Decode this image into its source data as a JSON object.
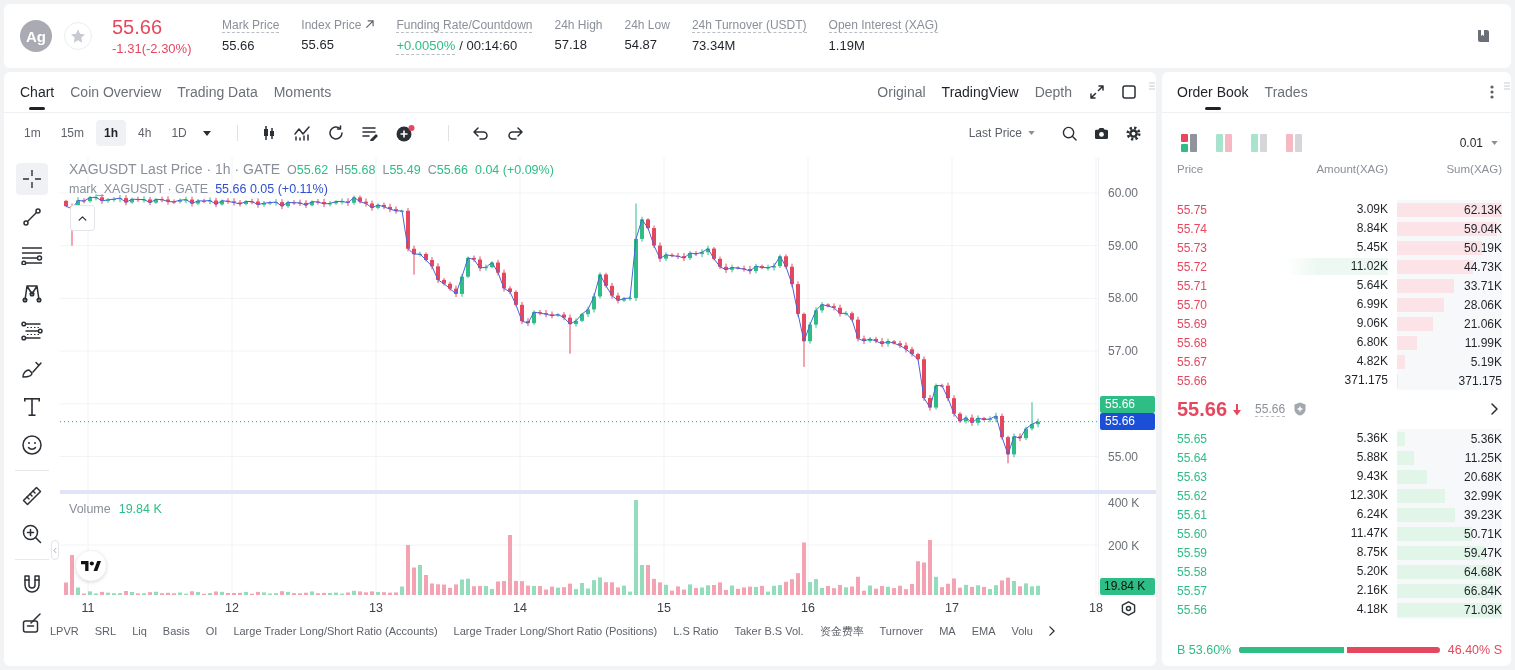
{
  "header": {
    "symbol": "Ag",
    "last_price": "55.66",
    "change": "-1.31(-2.30%)",
    "stats": [
      {
        "kind": "hint",
        "label": "Mark Price",
        "value": "55.66"
      },
      {
        "kind": "link",
        "label": "Index Price",
        "value": "55.65"
      },
      {
        "kind": "funding",
        "label": "Funding Rate/Countdown",
        "value": "+0.0050%",
        "countdown": "/ 00:14:60"
      },
      {
        "kind": "plain",
        "label": "24h High",
        "value": "57.18"
      },
      {
        "kind": "plain",
        "label": "24h Low",
        "value": "54.87"
      },
      {
        "kind": "hint",
        "label": "24h Turnover (USDT)",
        "value": "73.34M"
      },
      {
        "kind": "hint",
        "label": "Open Interest (XAG)",
        "value": "1.19M"
      }
    ]
  },
  "chart_panel": {
    "tabs": [
      {
        "label": "Chart",
        "selected": true
      },
      {
        "label": "Coin Overview",
        "selected": false
      },
      {
        "label": "Trading Data",
        "selected": false
      },
      {
        "label": "Moments",
        "selected": false
      }
    ],
    "views": [
      {
        "label": "Original",
        "selected": false
      },
      {
        "label": "TradingView",
        "selected": true
      },
      {
        "label": "Depth",
        "selected": false
      }
    ],
    "intervals": [
      {
        "label": "1m",
        "selected": false
      },
      {
        "label": "15m",
        "selected": false
      },
      {
        "label": "1h",
        "selected": true
      },
      {
        "label": "4h",
        "selected": false
      },
      {
        "label": "1D",
        "selected": false
      }
    ],
    "price_source": "Last Price",
    "drawing_tools": [
      {
        "selected": true
      },
      {
        "selected": false
      },
      {
        "selected": false
      },
      {
        "selected": false
      },
      {
        "selected": false
      },
      {
        "selected": false
      },
      {
        "selected": false
      },
      {
        "selected": false
      },
      {
        "selected": false
      },
      {
        "selected": false
      },
      {
        "selected": false
      },
      {
        "selected": false
      }
    ],
    "legend": {
      "title": "XAGUSDT Last Price · 1h · GATE",
      "ohlc": [
        {
          "key": "O",
          "value": "55.62"
        },
        {
          "key": "H",
          "value": "55.68"
        },
        {
          "key": "L",
          "value": "55.49"
        },
        {
          "key": "C",
          "value": "55.66"
        }
      ],
      "change": "0.04 (+0.09%)"
    },
    "mark_legend": {
      "title": "mark_XAGUSDT · GATE",
      "values": "55.66 0.05 (+0.11%)"
    },
    "price_axis": [
      "60.00",
      "59.00",
      "58.00",
      "57.00",
      "55.00"
    ],
    "price_badges": [
      {
        "value": "55.66",
        "color": "#2ebd85"
      },
      {
        "value": "55.66",
        "color": "#1c4fd8"
      }
    ],
    "volume": {
      "label": "Volume",
      "value": "19.84 K",
      "axis": [
        "400 K",
        "200 K"
      ],
      "badge": "19.84 K"
    },
    "time_axis": [
      "11",
      "12",
      "13",
      "14",
      "15",
      "16",
      "17",
      "18"
    ],
    "indicators": [
      "LPVR",
      "SRL",
      "Liq",
      "Basis",
      "OI",
      "Large Trader Long/Short Ratio (Accounts)",
      "Large Trader Long/Short Ratio (Positions)",
      "L.S Ratio",
      "Taker B.S Vol.",
      "资金费率",
      "Turnover",
      "MA",
      "EMA",
      "Volu"
    ]
  },
  "order_book": {
    "tabs": [
      {
        "label": "Order Book",
        "selected": true
      },
      {
        "label": "Trades",
        "selected": false
      }
    ],
    "layouts": [
      {
        "selected": true
      },
      {
        "selected": false
      },
      {
        "selected": false
      },
      {
        "selected": false
      }
    ],
    "precision": "0.01",
    "columns": [
      "Price",
      "Amount(XAG)",
      "Sum(XAG)"
    ],
    "asks": [
      {
        "price": "55.75",
        "amount": "3.09K",
        "sum": "62.13K",
        "level": 1.0,
        "highlighted": false
      },
      {
        "price": "55.74",
        "amount": "8.84K",
        "sum": "59.04K",
        "level": 0.95,
        "highlighted": false
      },
      {
        "price": "55.73",
        "amount": "5.45K",
        "sum": "50.19K",
        "level": 0.81,
        "highlighted": false
      },
      {
        "price": "55.72",
        "amount": "11.02K",
        "sum": "44.73K",
        "level": 0.72,
        "highlighted": true
      },
      {
        "price": "55.71",
        "amount": "5.64K",
        "sum": "33.71K",
        "level": 0.54,
        "highlighted": false
      },
      {
        "price": "55.70",
        "amount": "6.99K",
        "sum": "28.06K",
        "level": 0.45,
        "highlighted": false
      },
      {
        "price": "55.69",
        "amount": "9.06K",
        "sum": "21.06K",
        "level": 0.34,
        "highlighted": false
      },
      {
        "price": "55.68",
        "amount": "6.80K",
        "sum": "11.99K",
        "level": 0.19,
        "highlighted": false
      },
      {
        "price": "55.67",
        "amount": "4.82K",
        "sum": "5.19K",
        "level": 0.08,
        "highlighted": false
      },
      {
        "price": "55.66",
        "amount": "371.175",
        "sum": "371.175",
        "level": 0.01,
        "highlighted": false
      }
    ],
    "last_price": "55.66",
    "mark_price": "55.66",
    "bids": [
      {
        "price": "55.65",
        "amount": "5.36K",
        "sum": "5.36K",
        "level": 0.08,
        "highlighted": false
      },
      {
        "price": "55.64",
        "amount": "5.88K",
        "sum": "11.25K",
        "level": 0.16,
        "highlighted": false
      },
      {
        "price": "55.63",
        "amount": "9.43K",
        "sum": "20.68K",
        "level": 0.29,
        "highlighted": false
      },
      {
        "price": "55.62",
        "amount": "12.30K",
        "sum": "32.99K",
        "level": 0.46,
        "highlighted": false
      },
      {
        "price": "55.61",
        "amount": "6.24K",
        "sum": "39.23K",
        "level": 0.55,
        "highlighted": false
      },
      {
        "price": "55.60",
        "amount": "11.47K",
        "sum": "50.71K",
        "level": 0.71,
        "highlighted": false
      },
      {
        "price": "55.59",
        "amount": "8.75K",
        "sum": "59.47K",
        "level": 0.84,
        "highlighted": false
      },
      {
        "price": "55.58",
        "amount": "5.20K",
        "sum": "64.68K",
        "level": 0.91,
        "highlighted": false
      },
      {
        "price": "55.57",
        "amount": "2.16K",
        "sum": "66.84K",
        "level": 0.94,
        "highlighted": false
      },
      {
        "price": "55.56",
        "amount": "4.18K",
        "sum": "71.03K",
        "level": 1.0,
        "highlighted": false
      }
    ],
    "ratio": {
      "buy": "B 53.60%",
      "sell": "46.40% S",
      "level": 0.536
    }
  }
}
